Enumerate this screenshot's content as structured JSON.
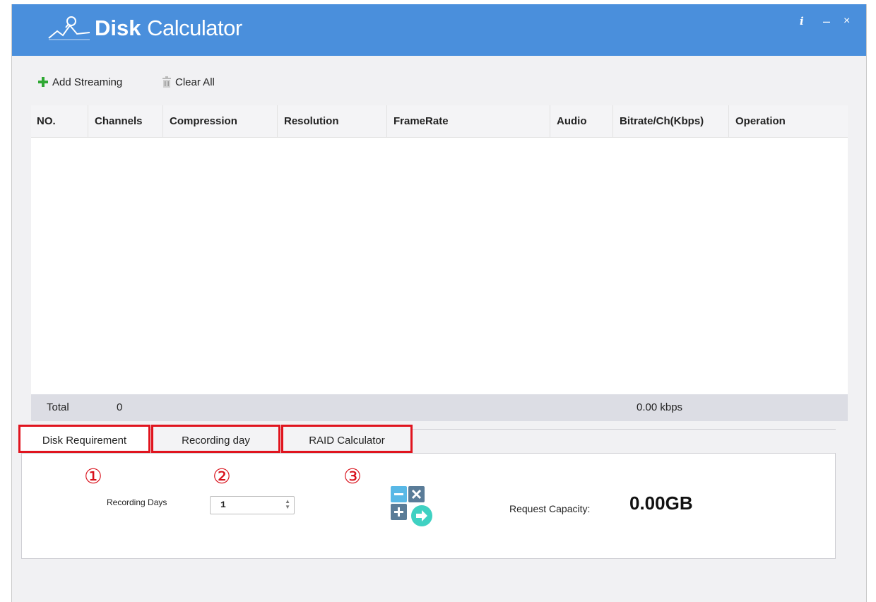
{
  "app": {
    "title_bold": "Disk",
    "title_light": "Calculator"
  },
  "window_controls": {
    "info": "i",
    "minimize": "–",
    "close": "×"
  },
  "toolbar": {
    "add_label": "Add Streaming",
    "clear_label": "Clear All"
  },
  "table": {
    "columns": [
      "NO.",
      "Channels",
      "Compression",
      "Resolution",
      "FrameRate",
      "Audio",
      "Bitrate/Ch(Kbps)",
      "Operation"
    ],
    "rows": []
  },
  "total": {
    "label": "Total",
    "channels": "0",
    "bitrate": "0.00 kbps"
  },
  "tabs": [
    {
      "label": "Disk Requirement",
      "active": true
    },
    {
      "label": "Recording day",
      "active": false
    },
    {
      "label": "RAID Calculator",
      "active": false
    }
  ],
  "markers": [
    "①",
    "②",
    "③"
  ],
  "disk_requirement": {
    "recording_days_label": "Recording Days",
    "recording_days_value": "1",
    "request_capacity_label": "Request Capacity:",
    "request_capacity_value": "0.00GB"
  },
  "colors": {
    "titlebar": "#4a8fdc",
    "highlight": "#e0141e",
    "add_icon": "#2fa833"
  },
  "icons": {
    "logo": "chart-magnifier-logo",
    "add": "plus-icon",
    "clear": "trash-icon",
    "calculate": "calculator-icon"
  }
}
